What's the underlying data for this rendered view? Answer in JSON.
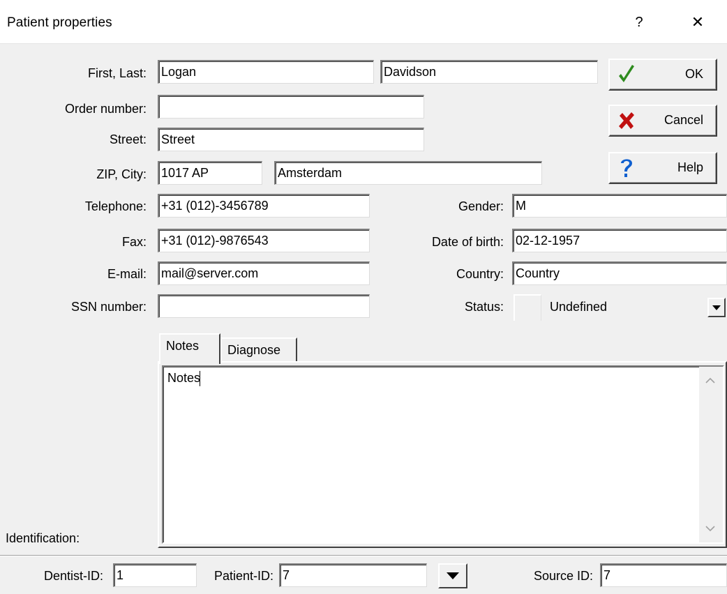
{
  "window": {
    "title": "Patient properties",
    "help_glyph": "?",
    "close_glyph": "✕"
  },
  "labels": {
    "first_last": "First, Last:",
    "order_number": "Order number:",
    "street": "Street:",
    "zip_city": "ZIP, City:",
    "telephone": "Telephone:",
    "fax": "Fax:",
    "email": "E-mail:",
    "ssn": "SSN number:",
    "gender": "Gender:",
    "dob": "Date of birth:",
    "country": "Country:",
    "status": "Status:",
    "identification": "Identification:",
    "dentist_id": "Dentist-ID:",
    "patient_id": "Patient-ID:",
    "source_id": "Source ID:"
  },
  "fields": {
    "first_name": "Logan",
    "last_name": "Davidson",
    "order_number": "",
    "street": "Street",
    "zip": "1017 AP",
    "city": "Amsterdam",
    "telephone": "+31 (012)-3456789",
    "fax": "+31 (012)-9876543",
    "email": "mail@server.com",
    "ssn": "",
    "gender": "M",
    "dob": "02-12-1957",
    "country": "Country",
    "status": "Undefined",
    "dentist_id": "1",
    "patient_id": "7",
    "source_id": "7"
  },
  "buttons": {
    "ok": "OK",
    "cancel": "Cancel",
    "help": "Help"
  },
  "icons": {
    "ok": "checkmark-icon",
    "cancel": "x-mark-icon",
    "help": "question-icon",
    "ok_color": "#2e8b1e",
    "cancel_color": "#c01010",
    "help_color": "#1060d0"
  },
  "tabs": [
    {
      "label": "Notes",
      "active": true
    },
    {
      "label": "Diagnose",
      "active": false
    }
  ],
  "notes_text": "Notes"
}
